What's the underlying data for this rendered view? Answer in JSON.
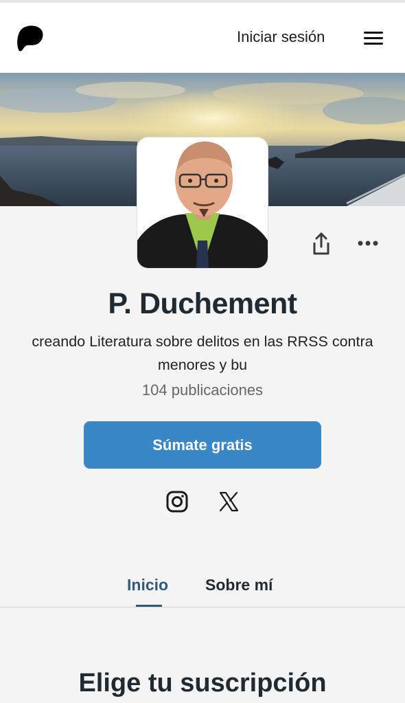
{
  "header": {
    "login_label": "Iniciar sesión"
  },
  "profile": {
    "name": "P. Duchement",
    "tagline": "creando Literatura sobre delitos en las RRSS contra menores y bu",
    "post_count": "104 publicaciones",
    "join_label": "Súmate gratis"
  },
  "social_icons": [
    "instagram-icon",
    "x-icon"
  ],
  "tabs": [
    {
      "label": "Inicio",
      "active": true
    },
    {
      "label": "Sobre mí",
      "active": false
    }
  ],
  "section": {
    "title": "Elige tu suscripción"
  },
  "colors": {
    "accent": "#3a87c8",
    "active_tab": "#2f5a7c",
    "background": "#f4f4f4",
    "text": "#1f2a33"
  }
}
